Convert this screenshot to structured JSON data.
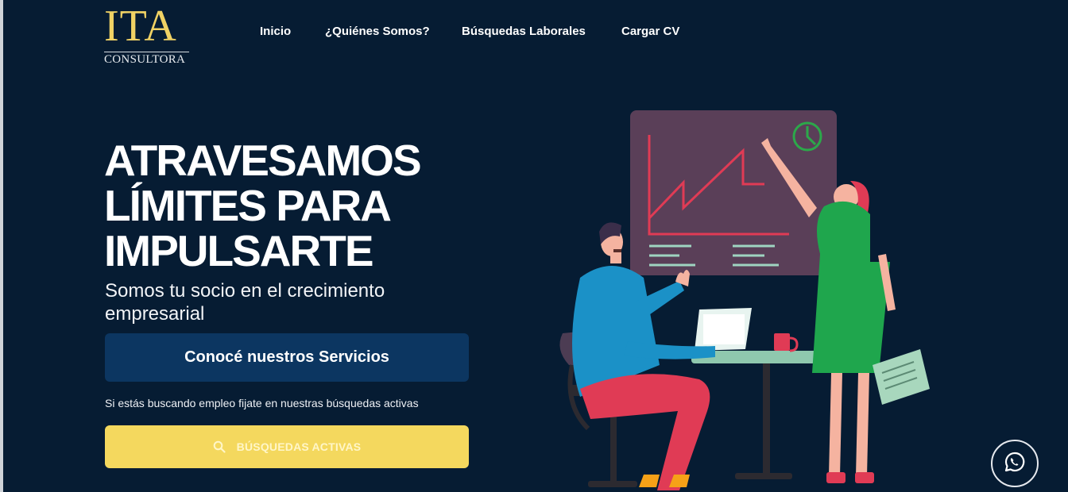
{
  "logo": {
    "main": "ITA",
    "sub": "CONSULTORA"
  },
  "nav": {
    "items": [
      {
        "label": "Inicio"
      },
      {
        "label": "¿Quiénes Somos?"
      },
      {
        "label": "Búsquedas Laborales"
      },
      {
        "label": "Cargar CV"
      }
    ]
  },
  "hero": {
    "headline_lines": [
      "ATRAVESAMOS",
      "LÍMITES PARA",
      "IMPULSARTE"
    ],
    "subtitle": "Somos tu socio en el crecimiento empresarial",
    "services_button": "Conocé nuestros Servicios",
    "note": "Si estás buscando empleo fijate en nuestras búsquedas activas",
    "search_button": "BÚSQUEDAS ACTIVAS"
  },
  "icons": {
    "search": "search-icon",
    "whatsapp": "whatsapp-icon"
  },
  "colors": {
    "background": "#061c33",
    "accent_yellow": "#f4d85e",
    "button_blue": "#0c3661",
    "logo_gold": "#f0d264"
  }
}
